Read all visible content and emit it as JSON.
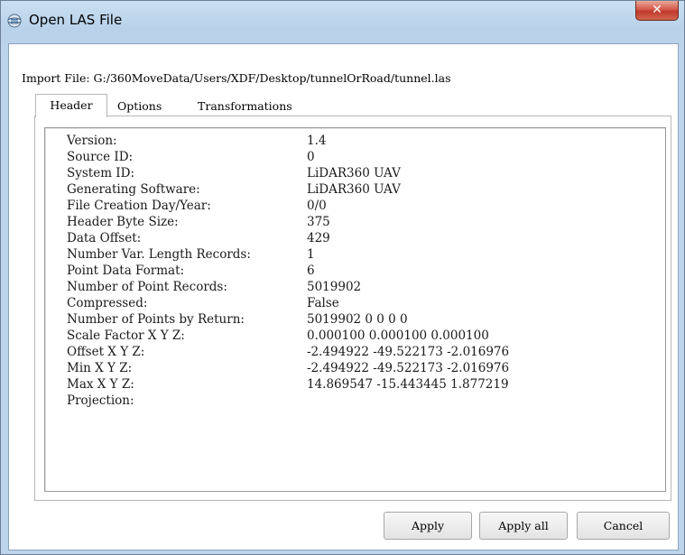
{
  "window": {
    "title": "Open LAS File",
    "close_glyph": "✕",
    "accent_close": "#c8442f"
  },
  "import_line": "Import File: G:/360MoveData/Users/XDF/Desktop/tunnelOrRoad/tunnel.las",
  "tabs": [
    {
      "label": "Header",
      "active": true
    },
    {
      "label": "Options",
      "active": false
    },
    {
      "label": "Transformations",
      "active": false
    }
  ],
  "header": {
    "rows": [
      {
        "label": "Version:",
        "value": "1.4"
      },
      {
        "label": "Source ID:",
        "value": "0"
      },
      {
        "label": "System ID:",
        "value": "LiDAR360 UAV"
      },
      {
        "label": "Generating Software:",
        "value": "LiDAR360 UAV"
      },
      {
        "label": "File Creation Day/Year:",
        "value": "0/0"
      },
      {
        "label": "Header Byte Size:",
        "value": "375"
      },
      {
        "label": "Data Offset:",
        "value": "429"
      },
      {
        "label": "Number Var. Length Records:",
        "value": "1"
      },
      {
        "label": "Point Data Format:",
        "value": "6"
      },
      {
        "label": "Number of Point Records:",
        "value": "5019902"
      },
      {
        "label": "Compressed:",
        "value": "False"
      },
      {
        "label": "Number of Points by Return:",
        "value": "5019902 0 0 0 0"
      },
      {
        "label": "Scale Factor X Y Z:",
        "value": "0.000100 0.000100 0.000100"
      },
      {
        "label": "Offset X Y Z:",
        "value": "-2.494922 -49.522173 -2.016976"
      },
      {
        "label": "Min X Y Z:",
        "value": "-2.494922 -49.522173 -2.016976"
      },
      {
        "label": "Max X Y Z:",
        "value": "14.869547 -15.443445 1.877219"
      },
      {
        "label": "Projection:",
        "value": ""
      }
    ]
  },
  "buttons": {
    "apply": "Apply",
    "apply_all": "Apply all",
    "cancel": "Cancel"
  },
  "icons": {
    "app": "las-file-icon",
    "close": "close-icon"
  }
}
